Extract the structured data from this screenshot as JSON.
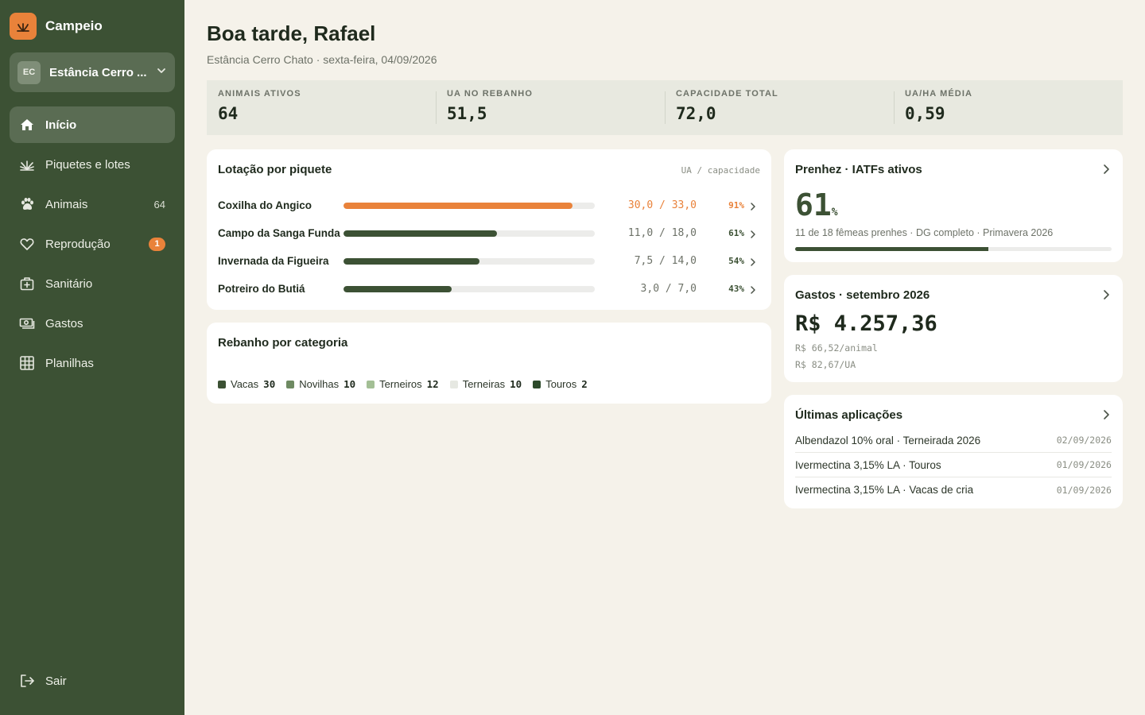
{
  "sidebar": {
    "brand": "Campeio",
    "farm": {
      "initials": "EC",
      "name": "Estância Cerro ..."
    },
    "items": [
      {
        "label": "Início",
        "icon": "home-icon",
        "active": true
      },
      {
        "label": "Piquetes e lotes",
        "icon": "grass-icon"
      },
      {
        "label": "Animais",
        "icon": "paw-icon",
        "count": "64"
      },
      {
        "label": "Reprodução",
        "icon": "heart-icon",
        "badge": "1"
      },
      {
        "label": "Sanitário",
        "icon": "medical-kit-icon"
      },
      {
        "label": "Gastos",
        "icon": "money-icon"
      },
      {
        "label": "Planilhas",
        "icon": "grid-icon"
      }
    ],
    "logout": "Sair"
  },
  "header": {
    "greeting": "Boa tarde, Rafael",
    "subline": "Estância Cerro Chato · sexta-feira, 04/09/2026"
  },
  "stats": [
    {
      "label": "ANIMAIS ATIVOS",
      "value": "64"
    },
    {
      "label": "UA NO REBANHO",
      "value": "51,5"
    },
    {
      "label": "CAPACIDADE TOTAL",
      "value": "72,0"
    },
    {
      "label": "UA/HA MÉDIA",
      "value": "0,59"
    }
  ],
  "lotacao": {
    "title": "Lotação por piquete",
    "unit": "UA / capacidade",
    "rows": [
      {
        "name": "Coxilha do Angico",
        "value": "30,0 / 33,0",
        "pct": "91%",
        "fraction": 0.91,
        "warn": true
      },
      {
        "name": "Campo da Sanga Funda",
        "value": "11,0 / 18,0",
        "pct": "61%",
        "fraction": 0.61,
        "warn": false
      },
      {
        "name": "Invernada da Figueira",
        "value": "7,5 / 14,0",
        "pct": "54%",
        "fraction": 0.54,
        "warn": false
      },
      {
        "name": "Potreiro do Butiá",
        "value": "3,0 / 7,0",
        "pct": "43%",
        "fraction": 0.43,
        "warn": false
      }
    ]
  },
  "rebanho": {
    "title": "Rebanho por categoria",
    "legend": [
      {
        "label": "Vacas",
        "count": "30",
        "color": "#3c5134"
      },
      {
        "label": "Novilhas",
        "count": "10",
        "color": "#6e8a62"
      },
      {
        "label": "Terneiros",
        "count": "12",
        "color": "#a3bf95"
      },
      {
        "label": "Terneiras",
        "count": "10",
        "color": "#e6e8e2"
      },
      {
        "label": "Touros",
        "count": "2",
        "color": "#2c4a2a"
      }
    ]
  },
  "prenhez": {
    "title": "Prenhez · IATFs ativos",
    "value": "61",
    "unit": "%",
    "fraction": 0.61,
    "description": "11 de 18 fêmeas prenhes · DG completo · Primavera 2026"
  },
  "gastos": {
    "title": "Gastos · setembro 2026",
    "total": "R$ 4.257,36",
    "per_animal": "R$ 66,52/animal",
    "per_ua": "R$ 82,67/UA"
  },
  "aplicacoes": {
    "title": "Últimas aplicações",
    "rows": [
      {
        "name": "Albendazol 10% oral · Terneirada 2026",
        "date": "02/09/2026"
      },
      {
        "name": "Ivermectina 3,15% LA · Touros",
        "date": "01/09/2026"
      },
      {
        "name": "Ivermectina 3,15% LA · Vacas de cria",
        "date": "01/09/2026"
      }
    ]
  },
  "colors": {
    "brand_green": "#3c5134",
    "accent_orange": "#e9823a",
    "background": "#f5f2ea"
  }
}
